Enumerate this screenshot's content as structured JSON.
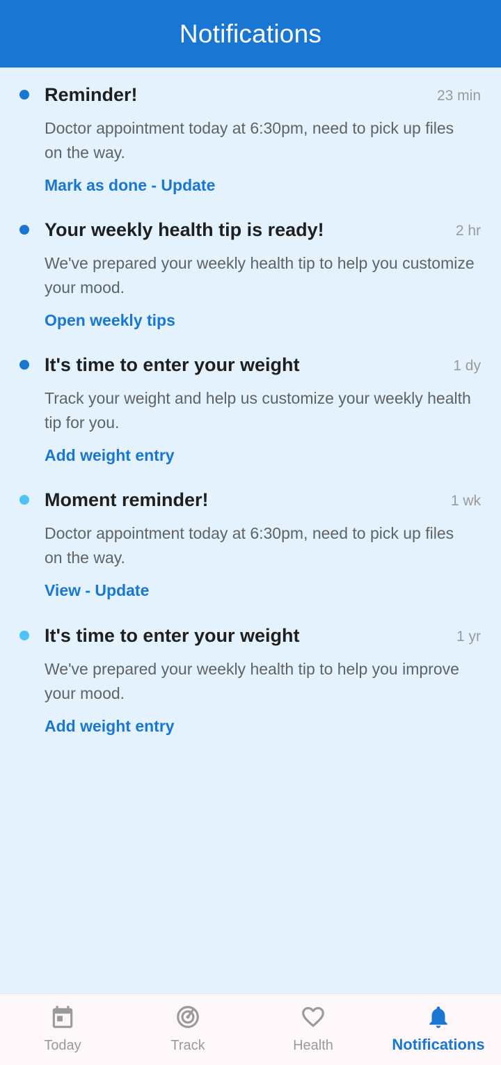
{
  "app_bar": {
    "title": "Notifications"
  },
  "notifications": [
    {
      "title": "Reminder!",
      "time": "23 min",
      "body": "Doctor appointment today at 6:30pm, need to pick up files on the way.",
      "action": "Mark as done - Update",
      "unread": true,
      "dot_color": "#1976D2"
    },
    {
      "title": "Your weekly health tip is ready!",
      "time": "2 hr",
      "body": "We've prepared your weekly health tip to help you customize your mood.",
      "action": "Open weekly tips",
      "unread": true,
      "dot_color": "#1976D2"
    },
    {
      "title": "It's time to enter your weight",
      "time": "1 dy",
      "body": "Track your weight and help us customize your weekly health tip for you.",
      "action": "Add weight entry",
      "unread": true,
      "dot_color": "#1976D2"
    },
    {
      "title": "Moment reminder!",
      "time": "1 wk",
      "body": "Doctor appointment today at 6:30pm, need to pick up files on the way.",
      "action": "View - Update",
      "unread": false,
      "dot_color": "#4FC3F7"
    },
    {
      "title": "It's time to enter your weight",
      "time": "1 yr",
      "body": "We've prepared your weekly health tip to help you improve your mood.",
      "action": "Add weight entry",
      "unread": false,
      "dot_color": "#4FC3F7"
    }
  ],
  "bottom_nav": {
    "items": [
      {
        "label": "Today",
        "icon": "calendar-icon",
        "active": false
      },
      {
        "label": "Track",
        "icon": "target-icon",
        "active": false
      },
      {
        "label": "Health",
        "icon": "heart-icon",
        "active": false
      },
      {
        "label": "Notifications",
        "icon": "bell-icon",
        "active": true
      }
    ]
  },
  "colors": {
    "primary": "#1976D2",
    "background": "#E3F2FD",
    "unread_dot": "#1976D2",
    "read_dot": "#4FC3F7",
    "nav_inactive": "#9A9A9A",
    "nav_background": "#FEF7FA"
  }
}
